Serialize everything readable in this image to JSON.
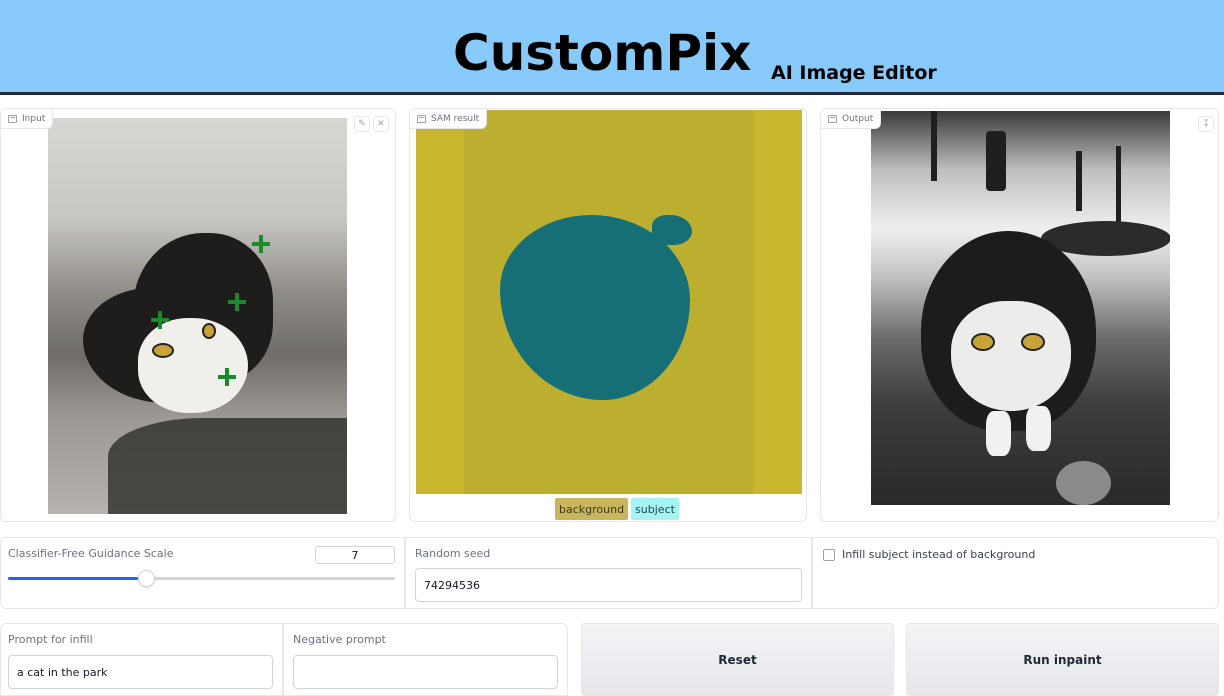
{
  "header": {
    "title": "CustomPix",
    "subtitle": "AI Image Editor"
  },
  "panels": {
    "input": {
      "label": "Input",
      "edit_icon": "pencil-icon",
      "clear_icon": "close-icon"
    },
    "sam": {
      "label": "SAM result",
      "legend": [
        "background",
        "subject"
      ]
    },
    "output": {
      "label": "Output",
      "download_icon": "download-icon"
    }
  },
  "colors": {
    "header_bg": "#87cafa",
    "background_mask": "#c9b62e",
    "subject_mask": "#166e76",
    "legend_background": "#c8b55c",
    "legend_subject": "#a5f3f3",
    "slider_accent": "#2563eb",
    "point_marker": "#1a8a2a"
  },
  "controls": {
    "guidance": {
      "label": "Classifier-Free Guidance Scale",
      "value": "7",
      "slider_fraction": 0.36
    },
    "seed": {
      "label": "Random seed",
      "value": "74294536"
    },
    "infill_subject": {
      "label": "Infill subject instead of background",
      "checked": false
    }
  },
  "prompts": {
    "prompt": {
      "label": "Prompt for infill",
      "value": "a cat in the park"
    },
    "negative": {
      "label": "Negative prompt",
      "value": ""
    }
  },
  "buttons": {
    "reset": "Reset",
    "run": "Run inpaint"
  }
}
